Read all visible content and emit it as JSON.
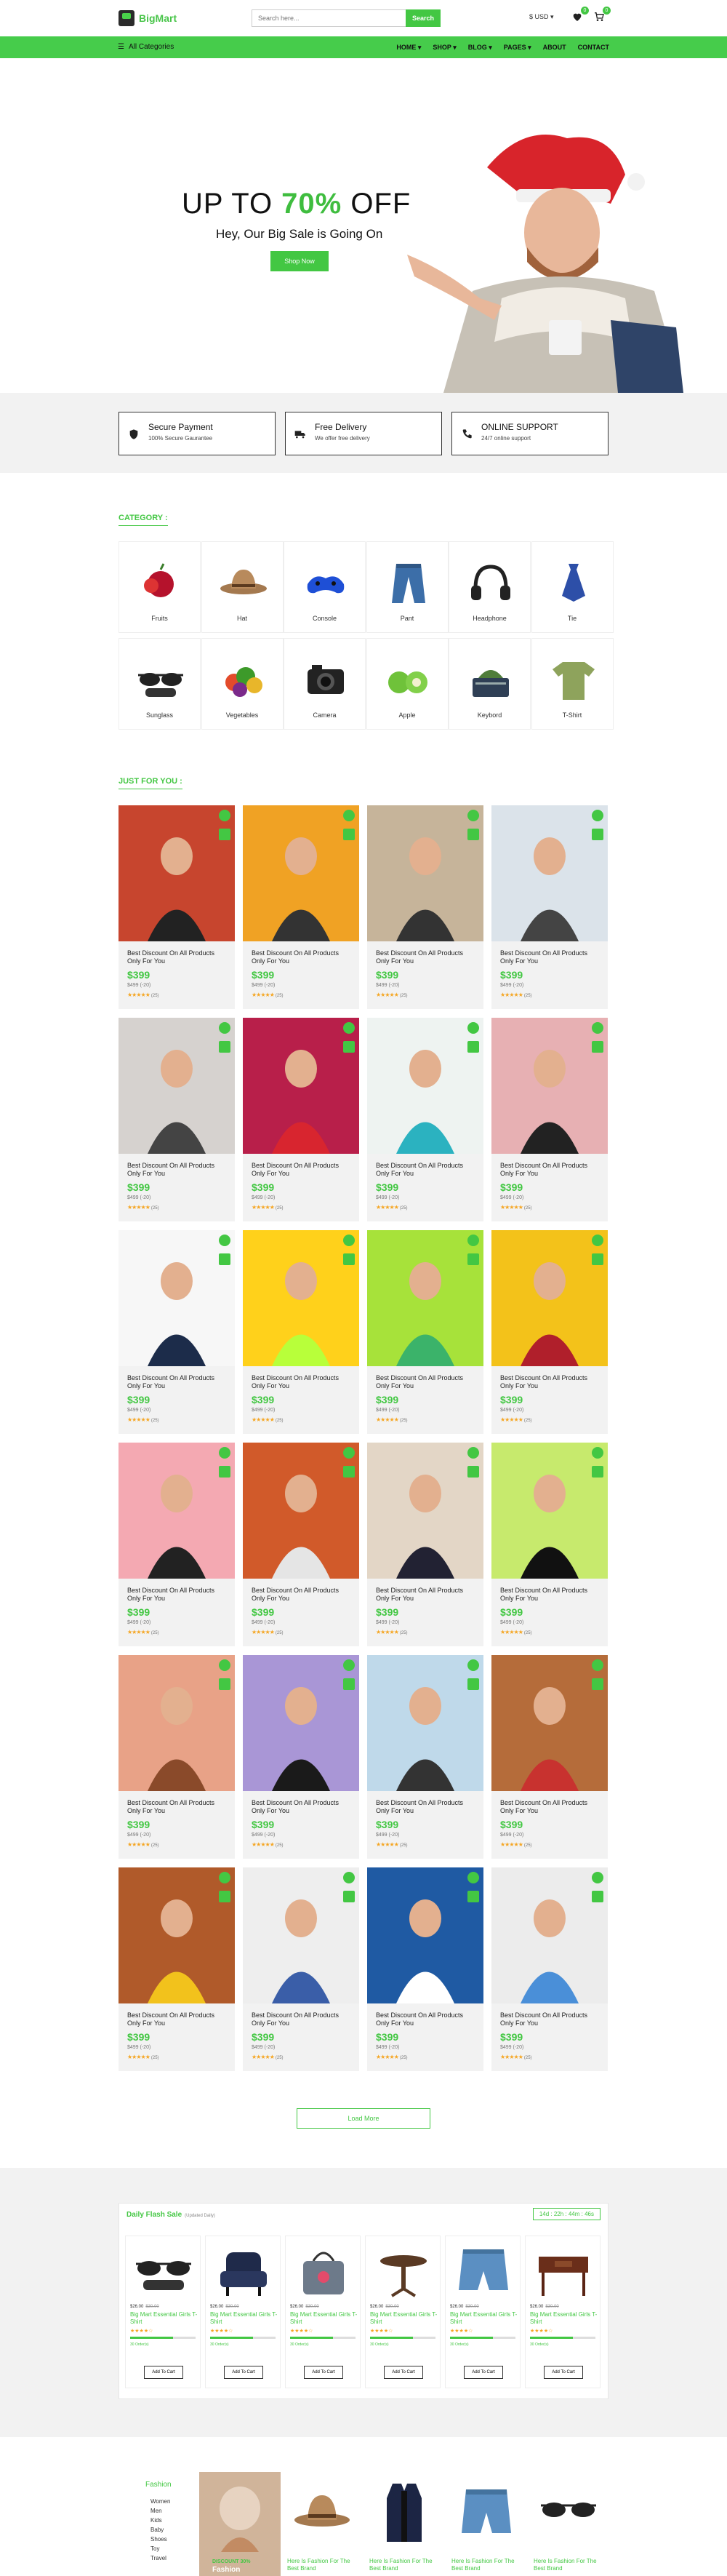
{
  "header": {
    "logo_text": "BigMart",
    "search_placeholder": "Search here...",
    "search_button": "Search",
    "currency": "$ USD",
    "wishlist_count": "0",
    "cart_count": "0"
  },
  "nav": {
    "all_categories": "All Categories",
    "menu": [
      "HOME",
      "SHOP",
      "BLOG",
      "PAGES",
      "ABOUT",
      "CONTACT"
    ]
  },
  "hero": {
    "title_prefix": "UP TO ",
    "title_percent": "70%",
    "title_suffix": " OFF",
    "subtitle": "Hey, Our Big Sale is Going On",
    "button": "Shop Now"
  },
  "features": [
    {
      "title": "Secure Payment",
      "subtitle": "100% Secure Gaurantee",
      "icon": "shield-icon"
    },
    {
      "title": "Free Delivery",
      "subtitle": "We offer free delivery",
      "icon": "truck-icon"
    },
    {
      "title": "ONLINE SUPPORT",
      "subtitle": "24/7 online support",
      "icon": "phone-icon"
    }
  ],
  "category_heading": "CATEGORY :",
  "categories": [
    "Fruits",
    "Hat",
    "Console",
    "Pant",
    "Headphone",
    "Tie",
    "Sunglass",
    "Vegetables",
    "Camera",
    "Apple",
    "Keybord",
    "T-Shirt"
  ],
  "just_for_you_heading": "JUST FOR YOU :",
  "product": {
    "name": "Best Discount On All Products Only For You",
    "price": "$399",
    "old_price": "$499 (-20)",
    "stars": "★★★★★",
    "reviews": "(25)"
  },
  "load_more": "Load More",
  "flash_sale": {
    "title": "Daily Flash Sale",
    "subtitle": "(Updated Daily)",
    "timer": "14d : 22h : 44m : 46s",
    "items": [
      {
        "tag_price": "$26.00",
        "old_price": "$30.00",
        "name": "Big Mart Essential Girls T-Shirt",
        "stars": "★★★★☆",
        "sold_pct": 65,
        "fav": "30 Order(s)",
        "button": "Add To Cart",
        "icon": "sunglasses-icon"
      },
      {
        "tag_price": "$26.00",
        "old_price": "$30.00",
        "name": "Big Mart Essential Girls T-Shirt",
        "stars": "★★★★☆",
        "sold_pct": 65,
        "fav": "30 Order(s)",
        "button": "Add To Cart",
        "icon": "armchair-icon"
      },
      {
        "tag_price": "$26.00",
        "old_price": "$30.00",
        "name": "Big Mart Essential Girls T-Shirt",
        "stars": "★★★★☆",
        "sold_pct": 65,
        "fav": "30 Order(s)",
        "button": "Add To Cart",
        "icon": "handbag-icon"
      },
      {
        "tag_price": "$26.00",
        "old_price": "$30.00",
        "name": "Big Mart Essential Girls T-Shirt",
        "stars": "★★★★☆",
        "sold_pct": 65,
        "fav": "30 Order(s)",
        "button": "Add To Cart",
        "icon": "table-icon"
      },
      {
        "tag_price": "$26.00",
        "old_price": "$30.00",
        "name": "Big Mart Essential Girls T-Shirt",
        "stars": "★★★★☆",
        "sold_pct": 65,
        "fav": "30 Order(s)",
        "button": "Add To Cart",
        "icon": "shorts-icon"
      },
      {
        "tag_price": "$26.00",
        "old_price": "$30.00",
        "name": "Big Mart Essential Girls T-Shirt",
        "stars": "★★★★☆",
        "sold_pct": 65,
        "fav": "30 Order(s)",
        "button": "Add To Cart",
        "icon": "desk-icon"
      }
    ]
  },
  "fashion": {
    "heading": "Fashion",
    "links": [
      "Women",
      "Men",
      "Kids",
      "Baby",
      "Shoes",
      "Toy",
      "Travel"
    ],
    "promo_label": "DISCOUNT 30%",
    "promo_title": "Fashion",
    "products": [
      {
        "name": "Here Is Fashion For The Best Brand",
        "icon": "hat-icon"
      },
      {
        "name": "Here Is Fashion For The Best Brand",
        "icon": "vest-icon"
      },
      {
        "name": "Here Is Fashion For The Best Brand",
        "icon": "shorts-icon"
      },
      {
        "name": "Here Is Fashion For The Best Brand",
        "icon": "sunglasses-icon"
      }
    ]
  },
  "colors": {
    "accent": "#46cc4b",
    "price": "#43c743",
    "star": "#f5a623"
  }
}
